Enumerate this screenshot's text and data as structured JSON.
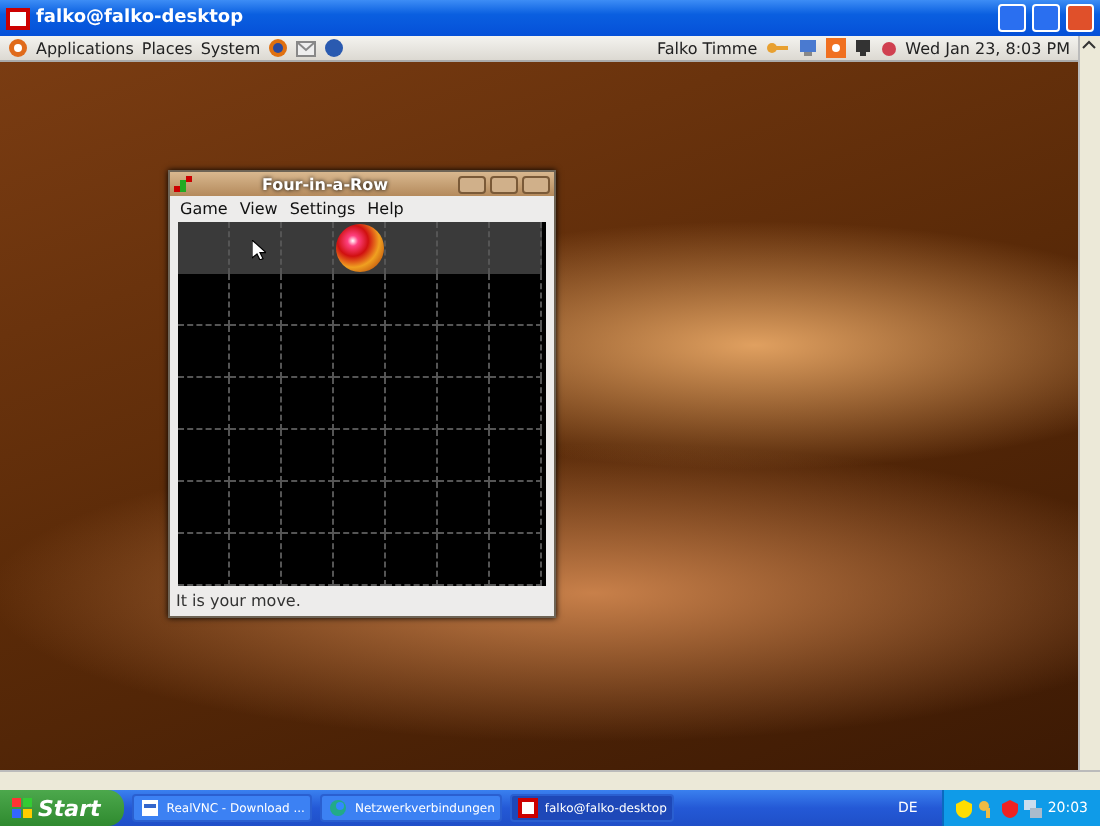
{
  "vnc_window": {
    "title": "falko@falko-desktop"
  },
  "panel": {
    "menus": [
      "Applications",
      "Places",
      "System"
    ],
    "user": "Falko Timme",
    "clock": "Wed Jan 23,  8:03 PM"
  },
  "game_window": {
    "title": "Four-in-a-Row",
    "menus": [
      "Game",
      "View",
      "Settings",
      "Help"
    ],
    "drop_row": [
      {
        "has_ball": false
      },
      {
        "has_ball": false
      },
      {
        "has_ball": false
      },
      {
        "has_ball": true
      },
      {
        "has_ball": false
      },
      {
        "has_ball": false
      },
      {
        "has_ball": false
      }
    ],
    "grid_rows": [
      [
        {
          "has_ball": false
        },
        {
          "has_ball": false
        },
        {
          "has_ball": false
        },
        {
          "has_ball": false
        },
        {
          "has_ball": false
        },
        {
          "has_ball": false
        },
        {
          "has_ball": false
        }
      ],
      [
        {
          "has_ball": false
        },
        {
          "has_ball": false
        },
        {
          "has_ball": false
        },
        {
          "has_ball": false
        },
        {
          "has_ball": false
        },
        {
          "has_ball": false
        },
        {
          "has_ball": false
        }
      ],
      [
        {
          "has_ball": false
        },
        {
          "has_ball": false
        },
        {
          "has_ball": false
        },
        {
          "has_ball": false
        },
        {
          "has_ball": false
        },
        {
          "has_ball": false
        },
        {
          "has_ball": false
        }
      ],
      [
        {
          "has_ball": false
        },
        {
          "has_ball": false
        },
        {
          "has_ball": false
        },
        {
          "has_ball": false
        },
        {
          "has_ball": false
        },
        {
          "has_ball": false
        },
        {
          "has_ball": false
        }
      ],
      [
        {
          "has_ball": false
        },
        {
          "has_ball": false
        },
        {
          "has_ball": false
        },
        {
          "has_ball": false
        },
        {
          "has_ball": false
        },
        {
          "has_ball": false
        },
        {
          "has_ball": false
        }
      ],
      [
        {
          "has_ball": false
        },
        {
          "has_ball": false
        },
        {
          "has_ball": false
        },
        {
          "has_ball": false
        },
        {
          "has_ball": false
        },
        {
          "has_ball": false
        },
        {
          "has_ball": false
        }
      ]
    ],
    "status": "It is your move."
  },
  "taskbar": {
    "start": "Start",
    "tasks": [
      {
        "label": "RealVNC - Download ...",
        "selected": false
      },
      {
        "label": "Netzwerkverbindungen",
        "selected": false
      },
      {
        "label": "falko@falko-desktop",
        "selected": true
      }
    ],
    "language": "DE",
    "time": "20:03"
  }
}
